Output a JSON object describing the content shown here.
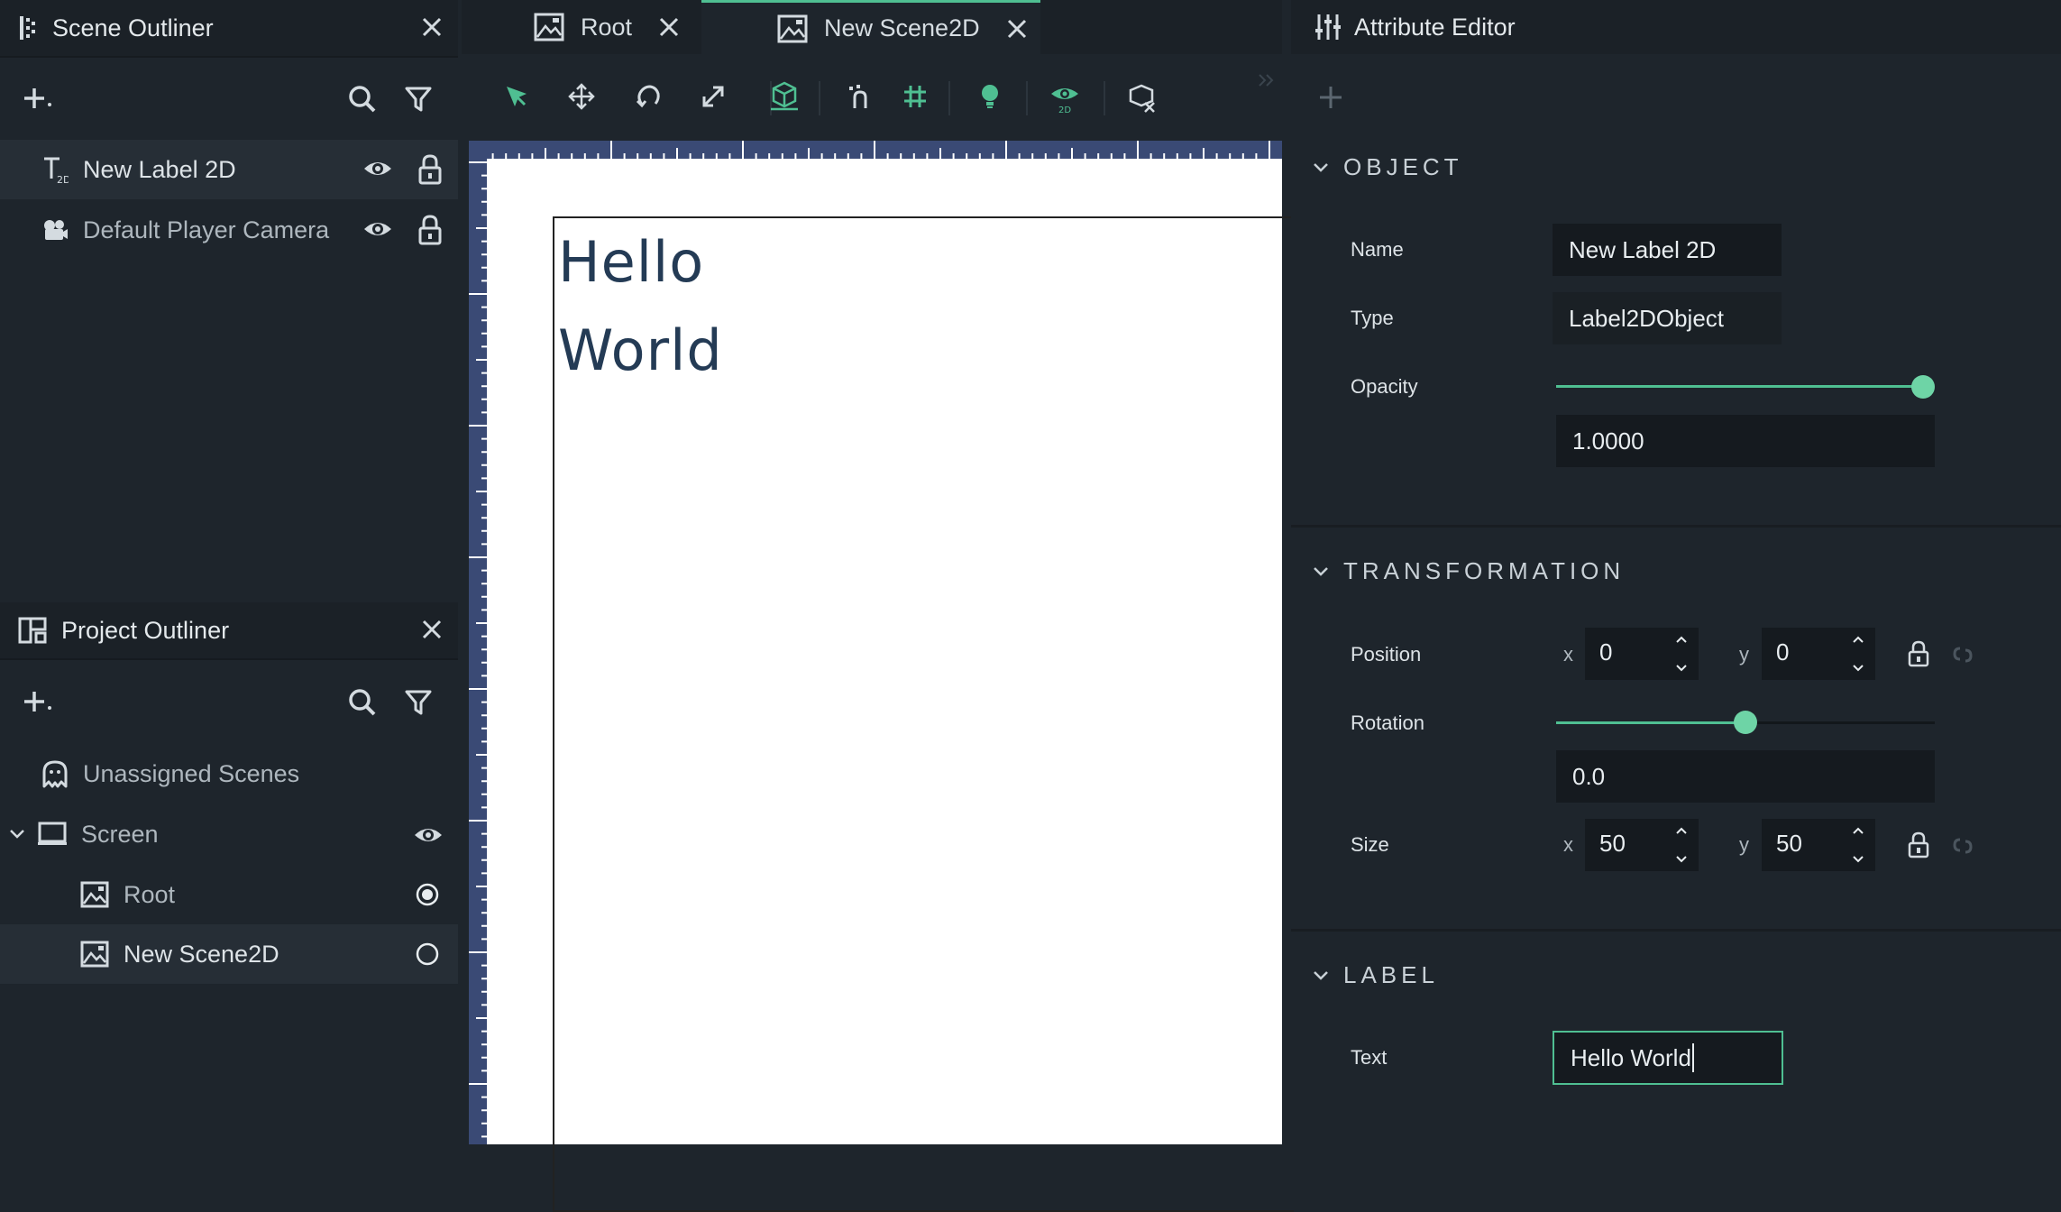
{
  "scene_outliner": {
    "title": "Scene Outliner",
    "items": [
      {
        "label": "New Label 2D"
      },
      {
        "label": "Default Player Camera"
      }
    ]
  },
  "project_outliner": {
    "title": "Project Outliner",
    "items": [
      {
        "label": "Unassigned Scenes"
      },
      {
        "label": "Screen"
      },
      {
        "label": "Root"
      },
      {
        "label": "New Scene2D"
      }
    ]
  },
  "tabs": [
    {
      "label": "Root"
    },
    {
      "label": "New Scene2D"
    }
  ],
  "canvas": {
    "line1": "Hello",
    "line2": "World"
  },
  "attribute_editor": {
    "title": "Attribute Editor",
    "object": {
      "heading": "OBJECT",
      "name_label": "Name",
      "name_value": "New Label 2D",
      "type_label": "Type",
      "type_value": "Label2DObject",
      "opacity_label": "Opacity",
      "opacity_value": "1.0000",
      "opacity_level": 1.0
    },
    "transformation": {
      "heading": "TRANSFORMATION",
      "position_label": "Position",
      "position_x": "0",
      "position_y": "0",
      "rotation_label": "Rotation",
      "rotation_value": "0.0",
      "rotation_level": 0.5,
      "size_label": "Size",
      "size_x": "50",
      "size_y": "50",
      "x_axis": "x",
      "y_axis": "y"
    },
    "label": {
      "heading": "LABEL",
      "text_label": "Text",
      "text_value": "Hello World"
    }
  },
  "colors": {
    "accent": "#4fbf92",
    "panel": "#1e252c",
    "header": "#1b2127",
    "ruler": "#3a4a75"
  }
}
